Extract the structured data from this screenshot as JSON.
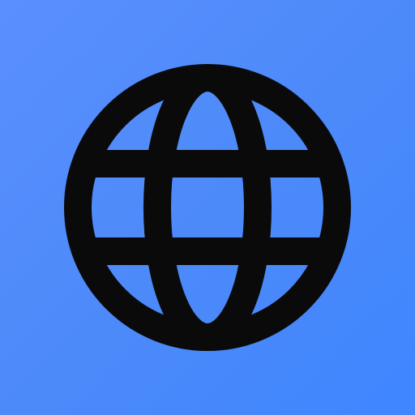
{
  "icon": {
    "name": "globe-icon",
    "background_color_start": "#5a8fff",
    "background_color_end": "#3f86ff",
    "stroke_color": "#0a0a0a"
  }
}
